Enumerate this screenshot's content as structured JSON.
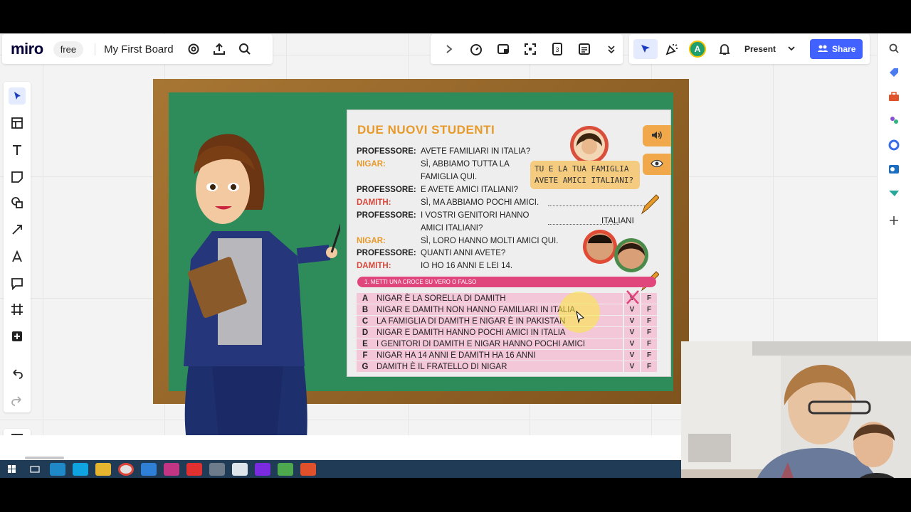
{
  "app": {
    "logo": "miro",
    "plan_badge": "free",
    "board_name": "My First Board"
  },
  "top_right": {
    "avatar_initial": "A",
    "present_label": "Present",
    "share_label": "Share"
  },
  "slide": {
    "title": "DUE NUOVI STUDENTI",
    "dialogue": [
      {
        "speaker": "PROFESSORE:",
        "role": "prof",
        "line1": "AVETE FAMILIARI IN ITALIA?",
        "line2": ""
      },
      {
        "speaker": "NIGAR:",
        "role": "nigar",
        "line1": "SÌ, ABBIAMO TUTTA LA",
        "line2": "FAMIGLIA QUI."
      },
      {
        "speaker": "PROFESSORE:",
        "role": "prof",
        "line1": "E AVETE AMICI ITALIANI?",
        "line2": ""
      },
      {
        "speaker": "DAMITH:",
        "role": "damith",
        "line1": "SÌ, MA ABBIAMO POCHI AMICI.",
        "line2": ""
      },
      {
        "speaker": "PROFESSORE:",
        "role": "prof",
        "line1": "I VOSTRI GENITORI HANNO",
        "line2": "AMICI ITALIANI?"
      },
      {
        "speaker": "NIGAR:",
        "role": "nigar",
        "line1": "SÌ, LORO HANNO MOLTI AMICI QUI.",
        "line2": ""
      },
      {
        "speaker": "PROFESSORE:",
        "role": "prof",
        "line1": "QUANTI ANNI AVETE?",
        "line2": ""
      },
      {
        "speaker": "DAMITH:",
        "role": "damith",
        "line1": "IO HO 16 ANNI E LEI 14.",
        "line2": ""
      }
    ],
    "bubble_line1": "TU E LA TUA FAMIGLIA",
    "bubble_line2": "AVETE AMICI ITALIANI?",
    "answer_suffix": "ITALIANI",
    "instruction": "1. METTI UNA CROCE SU VERO O FALSO",
    "v_label": "V",
    "f_label": "F",
    "questions": [
      {
        "letter": "A",
        "text": "NIGAR È LA SORELLA DI DAMITH"
      },
      {
        "letter": "B",
        "text": "NIGAR E DAMITH NON HANNO FAMILIARI IN ITALIA"
      },
      {
        "letter": "C",
        "text": "LA FAMIGLIA DI DAMITH E NIGAR È IN PAKISTAN"
      },
      {
        "letter": "D",
        "text": "NIGAR E DAMITH HANNO POCHI AMICI IN ITALIA"
      },
      {
        "letter": "E",
        "text": "I GENITORI DI DAMITH E NIGAR HANNO POCHI AMICI"
      },
      {
        "letter": "F",
        "text": "NIGAR HA 14 ANNI E DAMITH HA 16 ANNI"
      },
      {
        "letter": "G",
        "text": "DAMITH È IL FRATELLO DI NIGAR"
      }
    ]
  },
  "colors": {
    "board_green": "#2e8c5a",
    "frame_brown": "#9a6a2c",
    "title_orange": "#e79a2a",
    "instruction_pink": "#e0457b",
    "share_blue": "#4262ff"
  }
}
